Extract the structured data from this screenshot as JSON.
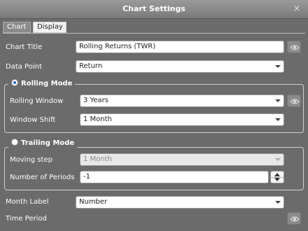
{
  "window": {
    "title": "Chart Settings",
    "close_glyph": "×"
  },
  "tabs": [
    {
      "label": "Chart",
      "active": true
    },
    {
      "label": "Display",
      "active": false
    }
  ],
  "fields": {
    "chart_title": {
      "label": "Chart Title",
      "value": "Rolling Returns (TWR)"
    },
    "data_point": {
      "label": "Data Point",
      "value": "Return"
    },
    "rolling_window": {
      "label": "Rolling Window",
      "value": "3 Years"
    },
    "window_shift": {
      "label": "Window Shift",
      "value": "1 Month"
    },
    "moving_step": {
      "label": "Moving step",
      "value": "1 Month"
    },
    "number_of_periods": {
      "label": "Number of Periods",
      "value": "-1"
    },
    "month_label": {
      "label": "Month Label",
      "value": "Number"
    },
    "time_period": {
      "label": "Time Period"
    }
  },
  "groups": {
    "rolling": {
      "legend": "Rolling Mode",
      "selected": true
    },
    "trailing": {
      "legend": "Trailing Mode",
      "selected": false
    }
  },
  "icons": {
    "eye": "eye-icon",
    "close": "close-icon",
    "dropdown": "chevron-down-icon"
  },
  "colors": {
    "background": "#6b6b6b",
    "titlebar": "#8a8a8a",
    "radio_selected": "#2a62b8"
  }
}
